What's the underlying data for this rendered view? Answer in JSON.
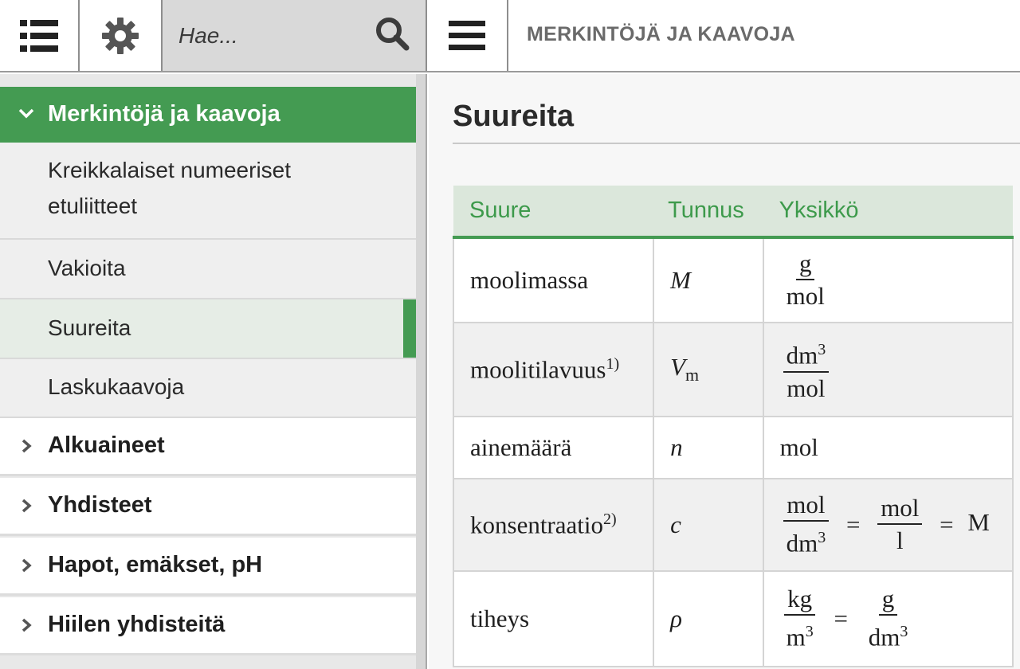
{
  "header": {
    "search_placeholder": "Hae...",
    "title": "MERKINTÖJÄ JA KAAVOJA"
  },
  "sidebar": {
    "section": "Merkintöjä ja kaavoja",
    "subitems": [
      {
        "label_line1": "Kreikkalaiset numeeriset",
        "label_line2": "etuliitteet"
      },
      {
        "label": "Vakioita"
      },
      {
        "label": "Suureita",
        "active": true
      },
      {
        "label": "Laskukaavoja"
      }
    ],
    "categories": [
      "Alkuaineet",
      "Yhdisteet",
      "Hapot, emäkset, pH",
      "Hiilen yhdisteitä"
    ]
  },
  "main": {
    "page_title": "Suureita",
    "table": {
      "headers": [
        "Suure",
        "Tunnus",
        "Yksikkö"
      ],
      "rows": [
        {
          "name": "moolimassa",
          "symbol": "M",
          "unit_num": "g",
          "unit_den": "mol"
        },
        {
          "name": "moolitilavuus",
          "note": "1)",
          "symbol": "V",
          "symbol_sub": "m",
          "unit_num": "dm",
          "unit_num_sup": "3",
          "unit_den": "mol"
        },
        {
          "name": "ainemäärä",
          "symbol": "n",
          "unit": "mol"
        },
        {
          "name": "konsentraatio",
          "note": "2)",
          "symbol": "c",
          "unit_a_num": "mol",
          "unit_a_den": "dm",
          "unit_a_den_sup": "3",
          "eq1": "=",
          "unit_b_num": "mol",
          "unit_b_den": "l",
          "eq2": "=",
          "unit_c": "M"
        },
        {
          "name": "tiheys",
          "symbol": "ρ",
          "unit_a_num": "kg",
          "unit_a_den": "m",
          "unit_a_den_sup": "3",
          "eq1": "=",
          "unit_b_num": "g",
          "unit_b_den": "dm",
          "unit_b_den_sup": "3"
        }
      ]
    }
  },
  "colors": {
    "accent_green": "#449b52",
    "header_row_bg": "#dbe7db",
    "search_bg": "#d9d9d9"
  },
  "icons": {
    "list": "list-icon",
    "settings": "gear-icon",
    "search": "search-icon",
    "menu": "hamburger-icon",
    "expanded": "chevron-down-icon",
    "collapsed": "chevron-right-icon"
  }
}
